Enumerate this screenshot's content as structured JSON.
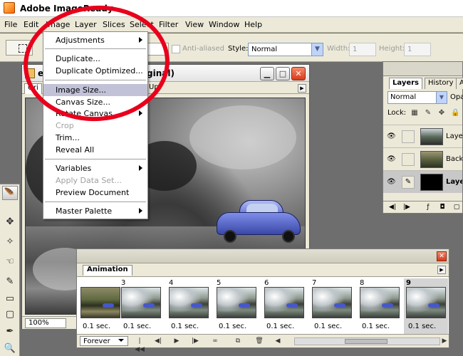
{
  "app": {
    "title": "Adobe ImageReady"
  },
  "menubar": {
    "items": [
      "File",
      "Edit",
      "Image",
      "Layer",
      "Slices",
      "Select",
      "Filter",
      "View",
      "Window",
      "Help"
    ]
  },
  "options": {
    "anti_aliased": "Anti-aliased",
    "style_label": "Style:",
    "style_value": "Normal",
    "width_label": "Width:",
    "width_value": "1",
    "height_label": "Height:",
    "height_value": "1"
  },
  "image_menu": {
    "items": [
      {
        "label": "Adjustments",
        "submenu": true,
        "disabled": false
      },
      {
        "label": "Duplicate...",
        "submenu": false,
        "disabled": false
      },
      {
        "label": "Duplicate Optimized...",
        "submenu": false,
        "disabled": false
      },
      {
        "label": "Image Size...",
        "submenu": false,
        "disabled": false
      },
      {
        "label": "Canvas Size...",
        "submenu": false,
        "disabled": false
      },
      {
        "label": "Rotate Canvas",
        "submenu": true,
        "disabled": false
      },
      {
        "label": "Crop",
        "submenu": false,
        "disabled": true
      },
      {
        "label": "Trim...",
        "submenu": false,
        "disabled": false
      },
      {
        "label": "Reveal All",
        "submenu": false,
        "disabled": false
      },
      {
        "label": "Variables",
        "submenu": true,
        "disabled": false
      },
      {
        "label": "Apply Data Set...",
        "submenu": false,
        "disabled": true
      },
      {
        "label": "Preview Document",
        "submenu": false,
        "disabled": false
      },
      {
        "label": "Master Palette",
        "submenu": true,
        "disabled": false
      }
    ],
    "highlighted": "Image Size..."
  },
  "document": {
    "title_prefix": "e",
    "title_suffix": "ginal)",
    "tabs": [
      "Ori",
      "Up"
    ],
    "zoom": "100%"
  },
  "layers_palette": {
    "tabs": [
      "Layers",
      "History",
      "A"
    ],
    "blend_mode": "Normal",
    "opacity_label": "Opa",
    "lock_label": "Lock:",
    "layers": [
      {
        "name": "Layer",
        "selected": false
      },
      {
        "name": "Backg",
        "selected": false
      },
      {
        "name": "Layer",
        "selected": true
      }
    ]
  },
  "animation": {
    "tab": "Animation",
    "loop": "Forever",
    "frames": [
      {
        "number": "",
        "time": "0.1 sec."
      },
      {
        "number": "3",
        "time": "0.1 sec."
      },
      {
        "number": "4",
        "time": "0.1 sec."
      },
      {
        "number": "5",
        "time": "0.1 sec."
      },
      {
        "number": "6",
        "time": "0.1 sec."
      },
      {
        "number": "7",
        "time": "0.1 sec."
      },
      {
        "number": "8",
        "time": "0.1 sec."
      },
      {
        "number": "9",
        "time": "0.1 sec."
      }
    ],
    "selected_frame": "9"
  },
  "colors": {
    "highlight": "#c1c1d7",
    "annotation_ring": "#e8001c",
    "car": "#4658c8"
  }
}
